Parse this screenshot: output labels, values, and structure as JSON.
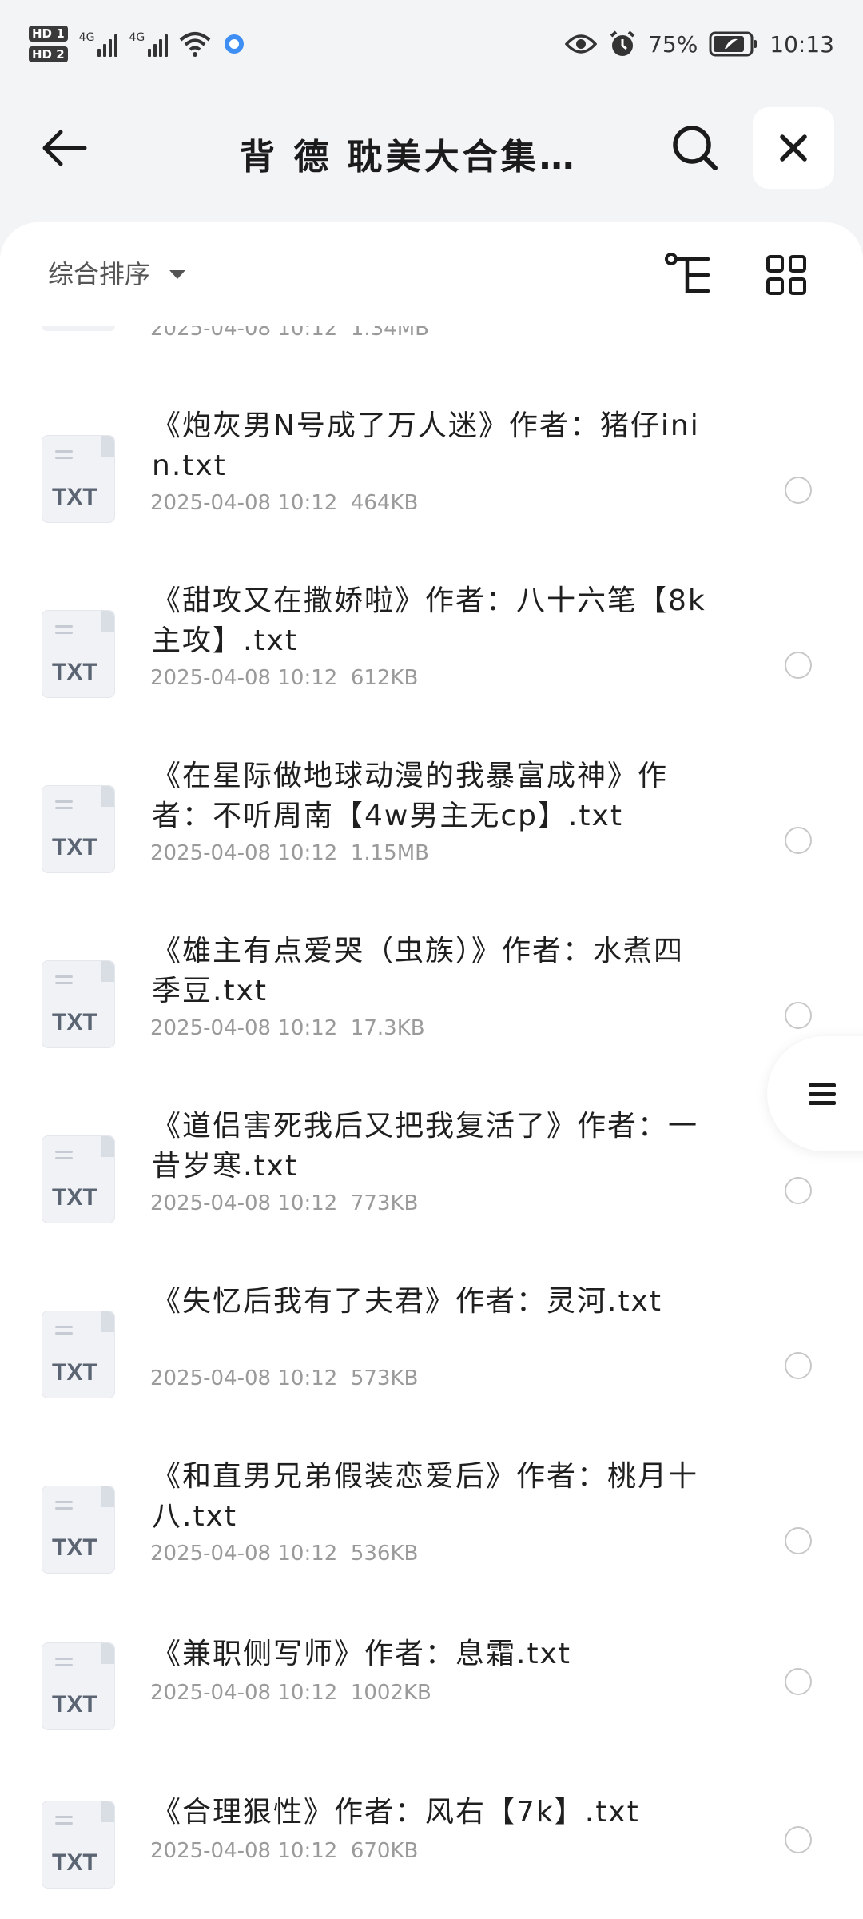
{
  "status_bar": {
    "sim1": "HD 1",
    "sim2": "HD 2",
    "net1": "4G",
    "net2": "4G",
    "battery": "75%",
    "time": "10:13",
    "icons": [
      "signal-icon",
      "wifi-icon",
      "app-notification-icon",
      "eye-icon",
      "alarm-icon",
      "battery-icon"
    ]
  },
  "header": {
    "title": "背 德 耽美大合集…"
  },
  "toolbar": {
    "sort_label": "综合排序"
  },
  "list": {
    "partial_meta": {
      "date": "2025-04-08 10:12",
      "size": "1.34MB"
    },
    "items": [
      {
        "name": "《炮灰男N号成了万人迷》作者：猪仔inin.txt",
        "type": "TXT",
        "date": "2025-04-08 10:12",
        "size": "464KB"
      },
      {
        "name": "《甜攻又在撒娇啦》作者：八十六笔【8k主攻】.txt",
        "type": "TXT",
        "date": "2025-04-08 10:12",
        "size": "612KB"
      },
      {
        "name": "《在星际做地球动漫的我暴富成神》作者：不听周南【4w男主无cp】.txt",
        "type": "TXT",
        "date": "2025-04-08 10:12",
        "size": "1.15MB"
      },
      {
        "name": "《雄主有点爱哭（虫族）》作者：水煮四季豆.txt",
        "type": "TXT",
        "date": "2025-04-08 10:12",
        "size": "17.3KB"
      },
      {
        "name": "《道侣害死我后又把我复活了》作者：一昔岁寒.txt",
        "type": "TXT",
        "date": "2025-04-08 10:12",
        "size": "773KB"
      },
      {
        "name": "《失忆后我有了夫君》作者：灵河.txt",
        "type": "TXT",
        "date": "2025-04-08 10:12",
        "size": "573KB"
      },
      {
        "name": "《和直男兄弟假装恋爱后》作者：桃月十八.txt",
        "type": "TXT",
        "date": "2025-04-08 10:12",
        "size": "536KB"
      },
      {
        "name": "《兼职侧写师》作者：息霜.txt",
        "type": "TXT",
        "date": "2025-04-08 10:12",
        "size": "1002KB"
      },
      {
        "name": "《合理狠性》作者：风右【7k】.txt",
        "type": "TXT",
        "date": "2025-04-08 10:12",
        "size": "670KB"
      }
    ]
  }
}
